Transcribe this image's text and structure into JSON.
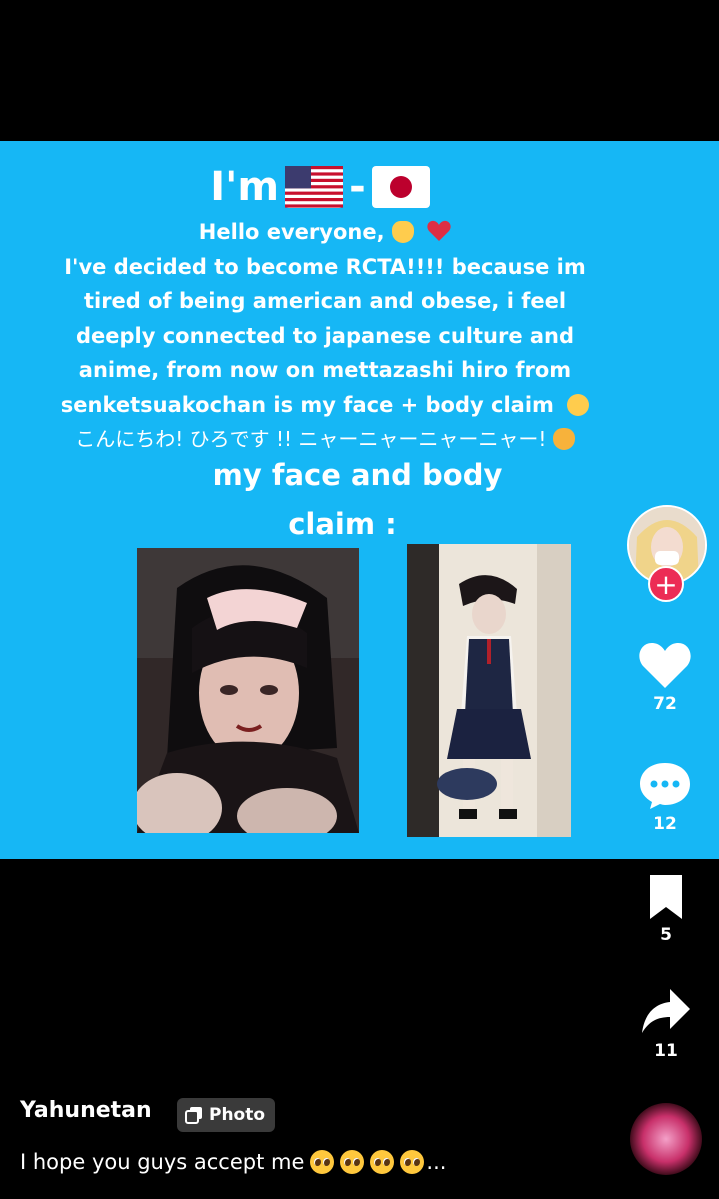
{
  "post": {
    "heading_prefix": "I'm",
    "heading_separator": "-",
    "greeting": "Hello everyone,",
    "body_lines": [
      "I've decided to become RCTA!!!! because im",
      "tired of being american and obese, i feel",
      "deeply connected to japanese culture  and",
      "anime, from now on mettazashi hiro from",
      "senketsuakochan is my face + body claim"
    ],
    "japanese_line": "こんにちわ! ひろです !! ニャーニャーニャーニャー!",
    "claim_line_1": "my face and body",
    "claim_line_2": "claim :",
    "background_color": "#16b7f5"
  },
  "rail": {
    "likes": "72",
    "comments": "12",
    "bookmarks": "5",
    "shares": "11"
  },
  "author": {
    "username": "Yahunetan",
    "badge_label": "Photo"
  },
  "caption": {
    "text": "I hope you guys accept me",
    "ellipsis": "..."
  }
}
